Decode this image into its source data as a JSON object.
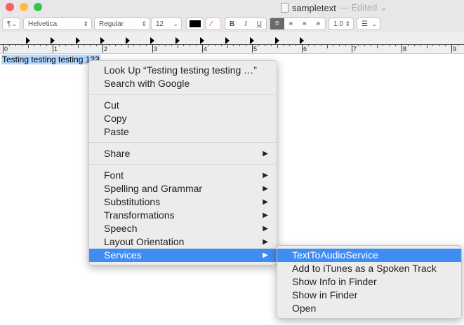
{
  "window": {
    "title": "sampletext",
    "status": "— Edited ⌄"
  },
  "toolbar": {
    "paragraph": "¶",
    "font": "Helvetica",
    "style": "Regular",
    "size": "12",
    "bold": "B",
    "italic": "I",
    "underline": "U",
    "spacing": "1.0",
    "list": "☰"
  },
  "ruler": {
    "labels": [
      "0",
      "1",
      "2",
      "3",
      "4",
      "5",
      "6",
      "7",
      "8",
      "9"
    ]
  },
  "document": {
    "text": "Testing testing testing 123"
  },
  "context_menu": {
    "groups": [
      [
        {
          "label": "Look Up “Testing testing testing …”"
        },
        {
          "label": "Search with Google"
        }
      ],
      [
        {
          "label": "Cut"
        },
        {
          "label": "Copy"
        },
        {
          "label": "Paste"
        }
      ],
      [
        {
          "label": "Share",
          "submenu": true
        }
      ],
      [
        {
          "label": "Font",
          "submenu": true
        },
        {
          "label": "Spelling and Grammar",
          "submenu": true
        },
        {
          "label": "Substitutions",
          "submenu": true
        },
        {
          "label": "Transformations",
          "submenu": true
        },
        {
          "label": "Speech",
          "submenu": true
        },
        {
          "label": "Layout Orientation",
          "submenu": true
        },
        {
          "label": "Services",
          "submenu": true,
          "highlighted": true
        }
      ]
    ]
  },
  "services_menu": {
    "items": [
      "TextToAudioService",
      "Add to iTunes as a Spoken Track",
      "Show Info in Finder",
      "Show in Finder",
      "Open"
    ],
    "highlighted": 0
  }
}
